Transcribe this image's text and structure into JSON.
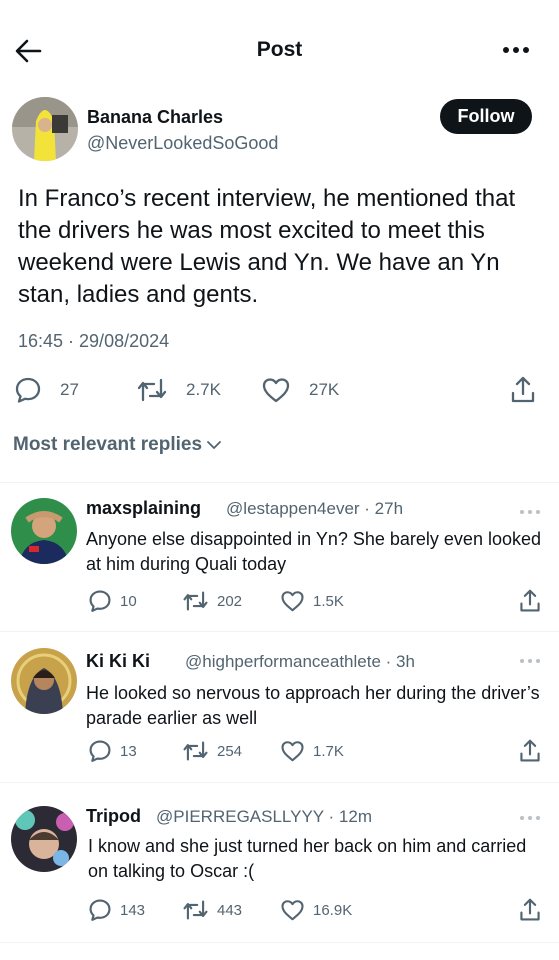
{
  "header": {
    "title": "Post",
    "back_icon": "arrow-left-icon",
    "more_icon": "more-horizontal-icon"
  },
  "post": {
    "author_name": "Banana Charles",
    "author_handle": "@NeverLookedSoGood",
    "follow_label": "Follow",
    "text": "In Franco’s recent interview, he mentioned that the drivers he was most excited to meet this weekend were Lewis and Yn. We have an Yn stan, ladies and gents.",
    "timestamp": "16:45 · 29/08/2024",
    "replies": "27",
    "reposts": "2.7K",
    "likes": "27K"
  },
  "replies_sort": {
    "label": "Most relevant replies"
  },
  "replies": [
    {
      "name": "maxsplaining",
      "handle": "@lestappen4ever · 27h",
      "text": "Anyone else disappointed in Yn? She barely even looked at him during Quali today",
      "replies": "10",
      "reposts": "202",
      "likes": "1.5K"
    },
    {
      "name": "Ki Ki Ki",
      "handle": "@highperformanceathlete · 3h",
      "text": "He looked so nervous to approach her during the driver’s parade earlier as well",
      "replies": "13",
      "reposts": "254",
      "likes": "1.7K"
    },
    {
      "name": "Tripod",
      "handle": "@PIERREGASLLYYY · 12m",
      "text": "I know and she just turned her back on him and carried on talking to Oscar :(",
      "replies": "143",
      "reposts": "443",
      "likes": "16.9K"
    }
  ],
  "colors": {
    "text": "#0f1419",
    "muted": "#536471",
    "divider": "#eff3f4",
    "button": "#0f1419"
  }
}
